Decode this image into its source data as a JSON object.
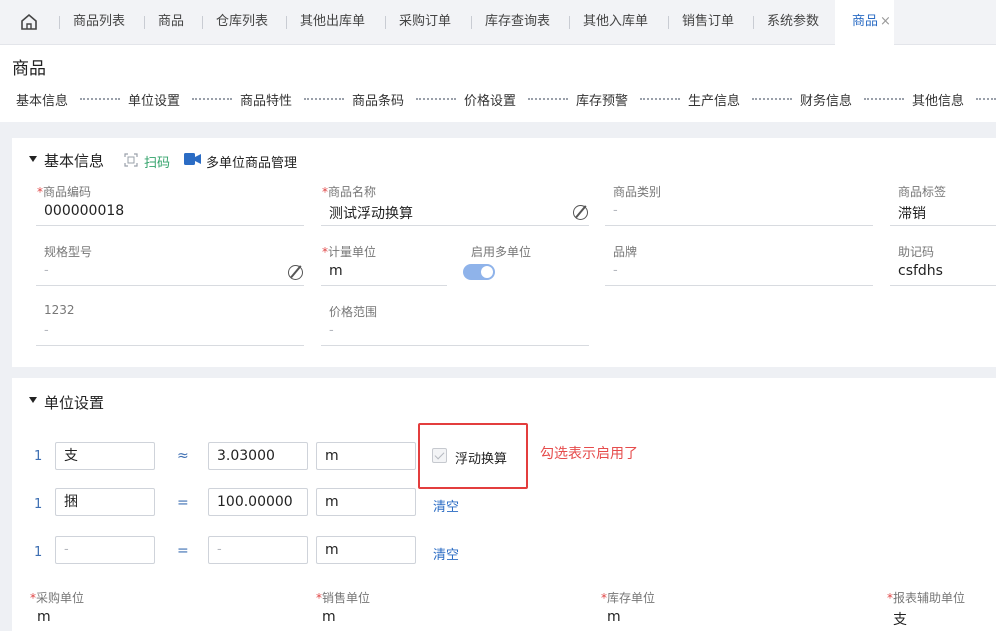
{
  "tabs": [
    {
      "label": "商品列表"
    },
    {
      "label": "商品"
    },
    {
      "label": "仓库列表"
    },
    {
      "label": "其他出库单"
    },
    {
      "label": "采购订单"
    },
    {
      "label": "库存查询表"
    },
    {
      "label": "其他入库单"
    },
    {
      "label": "销售订单"
    },
    {
      "label": "系统参数"
    }
  ],
  "active_tab": {
    "label": "商品",
    "close": "×"
  },
  "page_title": "商品",
  "anchors": [
    "基本信息",
    "单位设置",
    "商品特性",
    "商品条码",
    "价格设置",
    "库存预警",
    "生产信息",
    "财务信息",
    "其他信息"
  ],
  "basic": {
    "title": "基本信息",
    "scan_label": "扫码",
    "multi_unit_label": "多单位商品管理",
    "required_mark": "*",
    "fields": {
      "code": {
        "label": "商品编码",
        "value": "000000018"
      },
      "name": {
        "label": "商品名称",
        "value": "测试浮动换算"
      },
      "category": {
        "label": "商品类别",
        "value": "-"
      },
      "tag": {
        "label": "商品标签",
        "value": "滞销"
      },
      "spec": {
        "label": "规格型号",
        "value": "-"
      },
      "unit": {
        "label": "计量单位",
        "value": "m"
      },
      "multi_unit": {
        "label": "启用多单位",
        "enabled": true
      },
      "brand": {
        "label": "品牌",
        "value": "-"
      },
      "mnemonic": {
        "label": "助记码",
        "value": "csfdhs"
      },
      "custom": {
        "label": "1232",
        "value": "-"
      },
      "price_range": {
        "label": "价格范围",
        "value": "-"
      }
    }
  },
  "units": {
    "title": "单位设置",
    "rows": [
      {
        "index": "1",
        "unit": "支",
        "op": "≈",
        "rate": "3.03000",
        "base": "m"
      },
      {
        "index": "1",
        "unit": "捆",
        "op": "=",
        "rate": "100.00000",
        "base": "m",
        "clear": "清空"
      },
      {
        "index": "1",
        "unit": "-",
        "op": "=",
        "rate": "-",
        "base": "m",
        "clear": "清空"
      }
    ],
    "float_label": "浮动换算",
    "float_checked": true,
    "annotation": "勾选表示启用了",
    "bottom": [
      {
        "label": "采购单位",
        "value": "m"
      },
      {
        "label": "销售单位",
        "value": "m"
      },
      {
        "label": "库存单位",
        "value": "m"
      },
      {
        "label": "报表辅助单位",
        "value": "支"
      }
    ]
  },
  "colors": {
    "accent": "#2b6cc4",
    "highlight": "#e33d3d",
    "required": "#e04646"
  }
}
